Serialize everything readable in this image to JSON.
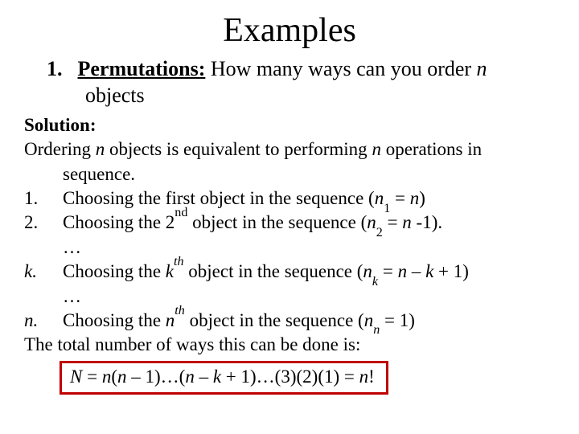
{
  "title": "Examples",
  "item": {
    "number": "1.",
    "label": "Permutations:",
    "rest_line1": " How many ways can you order ",
    "var_n": "n",
    "rest_line2": "objects"
  },
  "solution_label": "Solution:",
  "intro": {
    "a": "Ordering ",
    "b": " objects is equivalent to performing ",
    "c": " operations in",
    "d": "sequence."
  },
  "steps": {
    "s1": {
      "mk": "1.",
      "a": "Choosing the first object in the sequence (",
      "b": " = ",
      "c": ")"
    },
    "s2": {
      "mk": "2.",
      "a": "Choosing the 2",
      "nd": "nd",
      "b": " object in the sequence (",
      "c": " = ",
      "d": " -1).",
      "n2": "n"
    },
    "dots1": "…",
    "sk": {
      "mk": "k.",
      "a": "Choosing the ",
      "th": "th",
      "b": " object in the sequence (",
      "c": " = ",
      "d": " – ",
      "e": " + 1)"
    },
    "dots2": "…",
    "sn": {
      "mk": "n.",
      "a": "Choosing the ",
      "th": "th",
      "b": " object in the sequence (",
      "c": " = 1)"
    }
  },
  "total_line": "The total number of ways this can be done is:",
  "formula": {
    "lhs": "N",
    "eq": " = ",
    "p1a": "n",
    "p1b": "(",
    "p1c": "n",
    "p1d": " – 1)…(",
    "p2a": "n",
    "p2b": " – ",
    "p2c": "k",
    "p2d": " + 1)…(3)(2)(1) = ",
    "rhs": "n",
    "bang": "!"
  }
}
